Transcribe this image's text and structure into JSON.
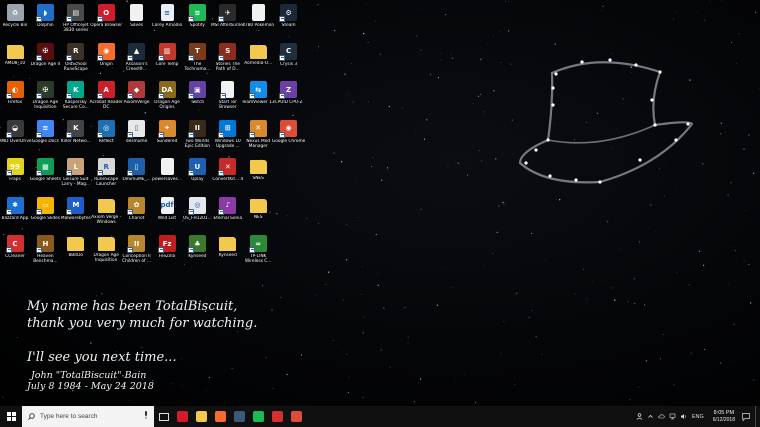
{
  "desktop": {
    "icons": [
      {
        "label": "Recycle Bin",
        "icon": "recycle-bin-icon",
        "color": "#9aa4ae",
        "glyph": "♻",
        "col": 0,
        "row": 0,
        "shortcut": false
      },
      {
        "label": "Dolphin",
        "icon": "dolphin-icon",
        "color": "#1d6fc9",
        "glyph": "◗",
        "col": 1,
        "row": 0,
        "shortcut": true
      },
      {
        "label": "HP Officejet 3830 series",
        "icon": "printer-icon",
        "color": "#4a4a4a",
        "glyph": "▤",
        "col": 2,
        "row": 0,
        "shortcut": true
      },
      {
        "label": "Opera Browser",
        "icon": "opera-icon",
        "color": "#d21b2b",
        "glyph": "O",
        "col": 3,
        "row": 0,
        "shortcut": true
      },
      {
        "label": "Saves",
        "icon": "file-icon",
        "color": "#f1f1f1",
        "glyph": "",
        "col": 4,
        "row": 0,
        "shortcut": false
      },
      {
        "label": "Corey Arnodio",
        "icon": "document-icon",
        "color": "#e9eef5",
        "glyph": "≡",
        "col": 5,
        "row": 0,
        "shortcut": false
      },
      {
        "label": "Spotify",
        "icon": "spotify-icon",
        "color": "#1db954",
        "glyph": "≋",
        "col": 6,
        "row": 0,
        "shortcut": true
      },
      {
        "label": "MSI Afterburner",
        "icon": "msi-afterburner-icon",
        "color": "#2a2a2a",
        "glyph": "✈",
        "col": 7,
        "row": 0,
        "shortcut": true
      },
      {
        "label": "4780 Pokemon ...",
        "icon": "file-icon",
        "color": "#f1f1f1",
        "glyph": "",
        "col": 8,
        "row": 0,
        "shortcut": false
      },
      {
        "label": "Steam",
        "icon": "steam-icon",
        "color": "#1b2838",
        "glyph": "⚙",
        "col": 9,
        "row": 0,
        "shortcut": true
      },
      {
        "label": "AMD8_10",
        "icon": "folder-icon",
        "color": "#f2c94c",
        "glyph": "",
        "col": 0,
        "row": 1,
        "shortcut": false
      },
      {
        "label": "Dragon Age II",
        "icon": "dragon-age-icon",
        "color": "#5a0d0d",
        "glyph": "✠",
        "col": 1,
        "row": 1,
        "shortcut": true
      },
      {
        "label": "OldSchool RuneScape",
        "icon": "runescape-icon",
        "color": "#3c3126",
        "glyph": "R",
        "col": 2,
        "row": 1,
        "shortcut": true
      },
      {
        "label": "Origin",
        "icon": "origin-icon",
        "color": "#f56c2d",
        "glyph": "◉",
        "col": 3,
        "row": 1,
        "shortcut": true
      },
      {
        "label": "Assassin's Creed®...",
        "icon": "assassins-creed-icon",
        "color": "#1e2b3b",
        "glyph": "▲",
        "col": 4,
        "row": 1,
        "shortcut": true
      },
      {
        "label": "Core Temp",
        "icon": "core-temp-icon",
        "color": "#c0392b",
        "glyph": "▥",
        "col": 5,
        "row": 1,
        "shortcut": true
      },
      {
        "label": "The Technomo...",
        "icon": "technomancer-icon",
        "color": "#7a3b1a",
        "glyph": "T",
        "col": 6,
        "row": 1,
        "shortcut": true
      },
      {
        "label": "Stories The Path of D...",
        "icon": "stories-icon",
        "color": "#8a2d1c",
        "glyph": "S",
        "col": 7,
        "row": 1,
        "shortcut": true
      },
      {
        "label": "Aornedia-U...",
        "icon": "folder-icon",
        "color": "#f2c94c",
        "glyph": "",
        "col": 8,
        "row": 1,
        "shortcut": false
      },
      {
        "label": "Crysis 3",
        "icon": "crysis-icon",
        "color": "#1f2f3e",
        "glyph": "C",
        "col": 9,
        "row": 1,
        "shortcut": true
      },
      {
        "label": "Firefox",
        "icon": "firefox-icon",
        "color": "#e66000",
        "glyph": "◐",
        "col": 0,
        "row": 2,
        "shortcut": true
      },
      {
        "label": "Dragon Age Inquisition",
        "icon": "dragon-age-icon",
        "color": "#2c3a2a",
        "glyph": "✠",
        "col": 1,
        "row": 2,
        "shortcut": true
      },
      {
        "label": "Kaspersky Secure Co...",
        "icon": "kaspersky-icon",
        "color": "#00a88e",
        "glyph": "K",
        "col": 2,
        "row": 2,
        "shortcut": true
      },
      {
        "label": "Acrobat Reader DC",
        "icon": "acrobat-icon",
        "color": "#c9202a",
        "glyph": "A",
        "col": 3,
        "row": 2,
        "shortcut": true
      },
      {
        "label": "AxiomVerge",
        "icon": "axiom-verge-icon",
        "color": "#b03a3a",
        "glyph": "◆",
        "col": 4,
        "row": 2,
        "shortcut": true
      },
      {
        "label": "Dragon Age Origins",
        "icon": "dragon-age-icon",
        "color": "#8a6a1a",
        "glyph": "DA",
        "col": 5,
        "row": 2,
        "shortcut": true
      },
      {
        "label": "Twitch",
        "icon": "twitch-icon",
        "color": "#6441a5",
        "glyph": "▣",
        "col": 6,
        "row": 2,
        "shortcut": true
      },
      {
        "label": "Start Tor Browser",
        "icon": "file-icon",
        "color": "#f1f1f1",
        "glyph": "",
        "col": 7,
        "row": 2,
        "shortcut": true
      },
      {
        "label": "TeamViewer 13",
        "icon": "teamviewer-icon",
        "color": "#0e8ee9",
        "glyph": "⇆",
        "col": 8,
        "row": 2,
        "shortcut": true
      },
      {
        "label": "CPUID CPU-Z",
        "icon": "cpuz-icon",
        "color": "#6f3fa8",
        "glyph": "Z",
        "col": 9,
        "row": 2,
        "shortcut": true
      },
      {
        "label": "AMD OverDrive",
        "icon": "amd-overdrive-icon",
        "color": "#3a3a3a",
        "glyph": "◒",
        "col": 0,
        "row": 3,
        "shortcut": true
      },
      {
        "label": "Google Docs",
        "icon": "google-docs-icon",
        "color": "#4285f4",
        "glyph": "≡",
        "col": 1,
        "row": 3,
        "shortcut": true
      },
      {
        "label": "Killer Netwo...",
        "icon": "killer-network-icon",
        "color": "#444444",
        "glyph": "K",
        "col": 2,
        "row": 3,
        "shortcut": true
      },
      {
        "label": "Reflect",
        "icon": "reflect-icon",
        "color": "#1c6fb3",
        "glyph": "◎",
        "col": 3,
        "row": 3,
        "shortcut": true
      },
      {
        "label": "desmume",
        "icon": "desmume-icon",
        "color": "#e8e8e8",
        "glyph": "▯",
        "col": 4,
        "row": 3,
        "shortcut": true
      },
      {
        "label": "Sundered",
        "icon": "sundered-icon",
        "color": "#d98a2c",
        "glyph": "✦",
        "col": 5,
        "row": 3,
        "shortcut": true
      },
      {
        "label": "Two Worlds Epic Edition",
        "icon": "two-worlds-icon",
        "color": "#3a2a1a",
        "glyph": "II",
        "col": 6,
        "row": 3,
        "shortcut": true
      },
      {
        "label": "Windows 10 Upgrade ...",
        "icon": "windows-icon",
        "color": "#0078d7",
        "glyph": "⊞",
        "col": 7,
        "row": 3,
        "shortcut": true
      },
      {
        "label": "Nexus Mod Manager",
        "icon": "nexus-icon",
        "color": "#d98a2c",
        "glyph": "✕",
        "col": 8,
        "row": 3,
        "shortcut": true
      },
      {
        "label": "Google Chrome",
        "icon": "chrome-icon",
        "color": "#dd4b39",
        "glyph": "◉",
        "col": 9,
        "row": 3,
        "shortcut": true
      },
      {
        "label": "Fraps",
        "icon": "fraps-icon",
        "color": "#e5d21a",
        "glyph": "99",
        "col": 0,
        "row": 4,
        "shortcut": true
      },
      {
        "label": "Google Sheets",
        "icon": "google-sheets-icon",
        "color": "#0f9d58",
        "glyph": "▦",
        "col": 1,
        "row": 4,
        "shortcut": true
      },
      {
        "label": "Leisure Suit Larry - Mag...",
        "icon": "larry-icon",
        "color": "#caa37a",
        "glyph": "L",
        "col": 2,
        "row": 4,
        "shortcut": true
      },
      {
        "label": "RuneScape Launcher",
        "icon": "runescape-icon",
        "color": "#d8d8d8",
        "glyph": "R",
        "col": 3,
        "row": 4,
        "shortcut": true
      },
      {
        "label": "DeSmuME_...",
        "icon": "desmume-icon",
        "color": "#1d5fa8",
        "glyph": "▯",
        "col": 4,
        "row": 4,
        "shortcut": true
      },
      {
        "label": "powersaves...",
        "icon": "file-icon",
        "color": "#f1f1f1",
        "glyph": "",
        "col": 5,
        "row": 4,
        "shortcut": false
      },
      {
        "label": "Uplay",
        "icon": "uplay-icon",
        "color": "#1e5fb3",
        "glyph": "U",
        "col": 6,
        "row": 4,
        "shortcut": true
      },
      {
        "label": "ConvertKit... 4",
        "icon": "convertkit-icon",
        "color": "#c82a2a",
        "glyph": "✕",
        "col": 7,
        "row": 4,
        "shortcut": true
      },
      {
        "label": "SNES",
        "icon": "folder-icon",
        "color": "#f2c94c",
        "glyph": "",
        "col": 8,
        "row": 4,
        "shortcut": false
      },
      {
        "label": "Blizzard App",
        "icon": "blizzard-icon",
        "color": "#1b6fd0",
        "glyph": "✱",
        "col": 0,
        "row": 5,
        "shortcut": true
      },
      {
        "label": "Google Slides",
        "icon": "google-slides-icon",
        "color": "#f4b400",
        "glyph": "▭",
        "col": 1,
        "row": 5,
        "shortcut": true
      },
      {
        "label": "Malwarebytes",
        "icon": "malwarebytes-icon",
        "color": "#1d5fc9",
        "glyph": "M",
        "col": 2,
        "row": 5,
        "shortcut": true
      },
      {
        "label": "Axiom Verge - Windows",
        "icon": "folder-icon",
        "color": "#f2c94c",
        "glyph": "",
        "col": 3,
        "row": 5,
        "shortcut": false
      },
      {
        "label": "Chariot",
        "icon": "chariot-icon",
        "color": "#b8862b",
        "glyph": "✿",
        "col": 4,
        "row": 5,
        "shortcut": true
      },
      {
        "label": "Wild List",
        "icon": "pdf-icon",
        "color": "#f1f1f1",
        "glyph": "pdf",
        "col": 5,
        "row": 5,
        "shortcut": false
      },
      {
        "label": "US_FH1201...",
        "icon": "gamepad-icon",
        "color": "#e6e6f0",
        "glyph": "◎",
        "col": 6,
        "row": 5,
        "shortcut": true
      },
      {
        "label": "Eternal Sonia",
        "icon": "eternal-sonata-icon",
        "color": "#8b3aa8",
        "glyph": "♪",
        "col": 7,
        "row": 5,
        "shortcut": true
      },
      {
        "label": "NES",
        "icon": "folder-icon",
        "color": "#f2c94c",
        "glyph": "",
        "col": 8,
        "row": 5,
        "shortcut": false
      },
      {
        "label": "CCleaner",
        "icon": "ccleaner-icon",
        "color": "#d32f2f",
        "glyph": "C",
        "col": 0,
        "row": 6,
        "shortcut": true
      },
      {
        "label": "Heaven Benchma...",
        "icon": "heaven-benchmark-icon",
        "color": "#8a5a1a",
        "glyph": "H",
        "col": 1,
        "row": 6,
        "shortcut": true
      },
      {
        "label": "8BitDo",
        "icon": "folder-icon",
        "color": "#f2c94c",
        "glyph": "",
        "col": 2,
        "row": 6,
        "shortcut": false
      },
      {
        "label": "Dragon Age Inquisition",
        "icon": "folder-icon",
        "color": "#f2c94c",
        "glyph": "",
        "col": 3,
        "row": 6,
        "shortcut": false
      },
      {
        "label": "Conception II Children of ...",
        "icon": "conception-icon",
        "color": "#b8862b",
        "glyph": "II",
        "col": 4,
        "row": 6,
        "shortcut": true
      },
      {
        "label": "FileZilla",
        "icon": "filezilla-icon",
        "color": "#bf1e1e",
        "glyph": "Fz",
        "col": 5,
        "row": 6,
        "shortcut": true
      },
      {
        "label": "Kynseed",
        "icon": "kynseed-icon",
        "color": "#3a7a2a",
        "glyph": "♣",
        "col": 6,
        "row": 6,
        "shortcut": true
      },
      {
        "label": "Kynseed",
        "icon": "folder-icon",
        "color": "#f2c94c",
        "glyph": "",
        "col": 7,
        "row": 6,
        "shortcut": false
      },
      {
        "label": "TP-LINK Wireless C...",
        "icon": "tp-link-icon",
        "color": "#2a8a3a",
        "glyph": "≈",
        "col": 8,
        "row": 6,
        "shortcut": true
      }
    ]
  },
  "tribute": {
    "line1": "My name has been TotalBiscuit,",
    "line2": "thank you very much for watching.",
    "line3": "I'll see you next time...",
    "name": "John \"TotalBiscuit\" Bain",
    "dates": "July 8 1984 - May 24 2018"
  },
  "taskbar": {
    "search_placeholder": "Type here to search",
    "apps": [
      {
        "name": "task-view",
        "color": "#e0e0e0",
        "active": false
      },
      {
        "name": "taskbar-app-opera",
        "color": "#d21b2b",
        "active": false
      },
      {
        "name": "taskbar-app-file-explorer",
        "color": "#f2c94c",
        "active": false
      },
      {
        "name": "taskbar-app-origin",
        "color": "#f56c2d",
        "active": false
      },
      {
        "name": "taskbar-app-steam",
        "color": "#3a5a7a",
        "active": false
      },
      {
        "name": "taskbar-app-spotify",
        "color": "#1db954",
        "active": false
      },
      {
        "name": "taskbar-app-ccleaner",
        "color": "#d32f2f",
        "active": false
      },
      {
        "name": "taskbar-app-chrome",
        "color": "#dd4b39",
        "active": false
      }
    ],
    "tray": {
      "language": "ENG",
      "time": "8:05 PM",
      "date": "6/12/2018"
    }
  }
}
